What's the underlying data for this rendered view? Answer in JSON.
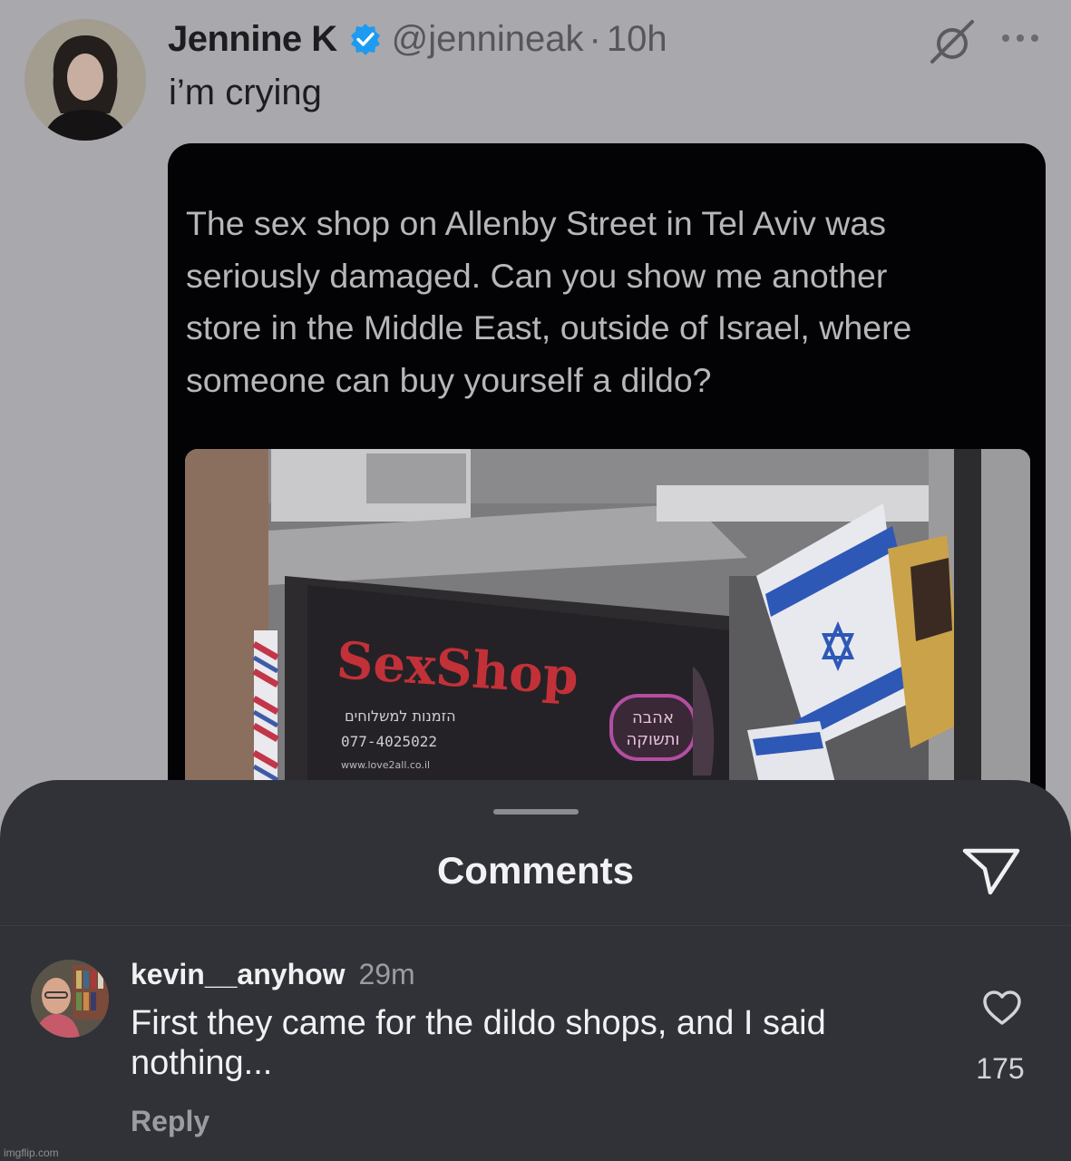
{
  "tweet": {
    "author_name": "Jennine K",
    "handle": "@jennineak",
    "separator": "·",
    "time": "10h",
    "text": "i’m crying",
    "icons": {
      "verified": "verified-badge-icon",
      "grok": "grok-icon",
      "more": "more-options-icon"
    },
    "colors": {
      "verified": "#1d9bf0"
    }
  },
  "quoted_post": {
    "text": "The sex shop on Allenby Street in Tel Aviv was\nseriously damaged. Can you show me another\nstore in the Middle East, outside of Israel, where\nsomeone can buy yourself a dildo?",
    "photo": {
      "sign_brand": "SexShop",
      "sign_hebrew": "הזמנות למשלוחים",
      "sign_phone": "077-4025022",
      "sign_url": "www.love2all.co.il",
      "badge_line1": "אהבה",
      "badge_line2": "ותשוקה"
    }
  },
  "comments_sheet": {
    "title": "Comments",
    "icons": {
      "share": "send-icon",
      "like": "heart-icon"
    },
    "comments": [
      {
        "username": "kevin__anyhow",
        "time": "29m",
        "text": "First they came for the dildo shops, and I said nothing...",
        "reply_label": "Reply",
        "likes": "175"
      }
    ]
  },
  "watermark": "imgflip.com"
}
